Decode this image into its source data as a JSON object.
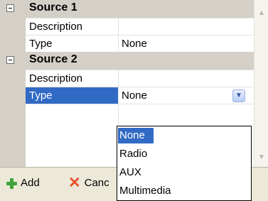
{
  "categories": [
    {
      "title": "Source 1",
      "properties": [
        {
          "name": "Description",
          "value": ""
        },
        {
          "name": "Type",
          "value": "None"
        }
      ]
    },
    {
      "title": "Source 2",
      "properties": [
        {
          "name": "Description",
          "value": ""
        },
        {
          "name": "Type",
          "value": "None"
        }
      ]
    }
  ],
  "dropdown": {
    "options": [
      "None",
      "Radio",
      "AUX",
      "Multimedia"
    ],
    "selected": "None"
  },
  "toolbar": {
    "add_label": "Add",
    "cancel_label": "Canc"
  }
}
